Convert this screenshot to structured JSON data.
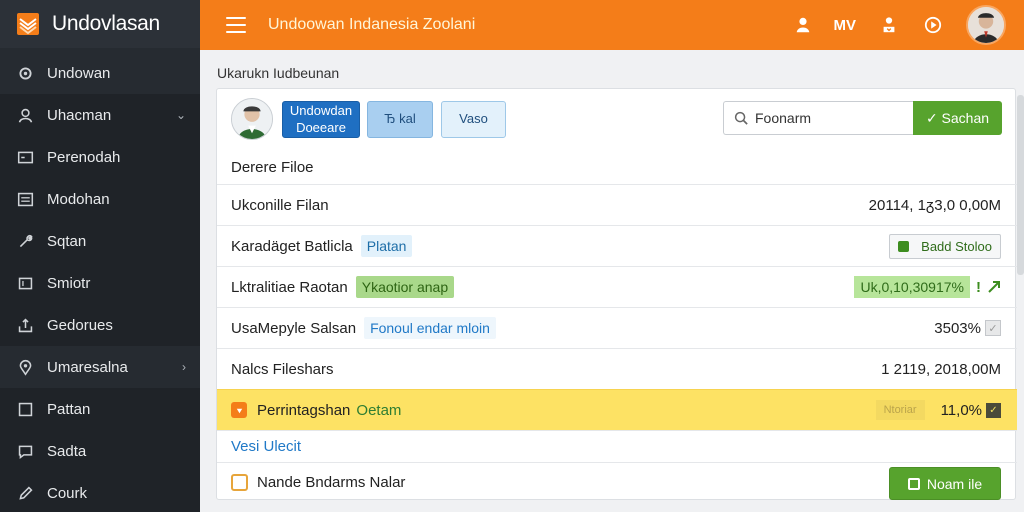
{
  "app": {
    "brand": "Undovlasan",
    "top_title": "Undoowan Indanesia Zoolani",
    "top_text": "MV"
  },
  "sidebar": {
    "items": [
      {
        "label": "Undowan",
        "icon": "gear-icon",
        "chevron": ""
      },
      {
        "label": "Uhacman",
        "icon": "user-icon",
        "chevron": "⌄"
      },
      {
        "label": "Perenodah",
        "icon": "window-icon",
        "chevron": ""
      },
      {
        "label": "Modohan",
        "icon": "list-icon",
        "chevron": ""
      },
      {
        "label": "Sqtan",
        "icon": "tool-icon",
        "chevron": ""
      },
      {
        "label": "Smiotr",
        "icon": "box-icon",
        "chevron": ""
      },
      {
        "label": "Gedorues",
        "icon": "upload-icon",
        "chevron": ""
      },
      {
        "label": "Umaresalna",
        "icon": "pin-icon",
        "chevron": "›"
      },
      {
        "label": "Pattan",
        "icon": "page-icon",
        "chevron": ""
      },
      {
        "label": "Sadta",
        "icon": "chat-icon",
        "chevron": ""
      },
      {
        "label": "Courk",
        "icon": "pen-icon",
        "chevron": ""
      }
    ]
  },
  "breadcrumb": "Ukarukn Iudbeunan",
  "toolbar": {
    "primary_label": "Undowdan Doeeare",
    "btn_b_label": "Ђ kal",
    "btn_c_label": "Vaso",
    "search_value": "Foonarm",
    "search_button": "✓ Sachan"
  },
  "rows": [
    {
      "label": "Derere Filoe"
    },
    {
      "label": "Ukconille Filan",
      "right": "20114, 1ᵹ3,0 0,00M"
    },
    {
      "label": "Karadäget Batlicla",
      "tag": "Platan",
      "status": "Badd Stoloo"
    },
    {
      "label": "Lktralitiae Raotan",
      "tag": "Ykaotior anap",
      "pct": "Uk,0,10,30917%",
      "mark": "!"
    },
    {
      "label": "UsaMepyle Salsan",
      "tag": "Fonoul endar mloin",
      "right": "3503%"
    },
    {
      "label": "Nalcs Fileshars",
      "right": "1 2119, 2018,00M"
    },
    {
      "label": "Perrintagshan",
      "tag": "Oetam",
      "faint": "Ntoriar",
      "right": "11,0%"
    }
  ],
  "link_row": "Vesi Ulecit",
  "footer": {
    "label": "Nande Bndarms Nalar",
    "button": "Noam ile"
  },
  "colors": {
    "topbar": "#f47d19",
    "sidebar": "#262b31",
    "primary": "#1f6fc2",
    "success": "#57a32d",
    "highlight": "#fde264"
  }
}
